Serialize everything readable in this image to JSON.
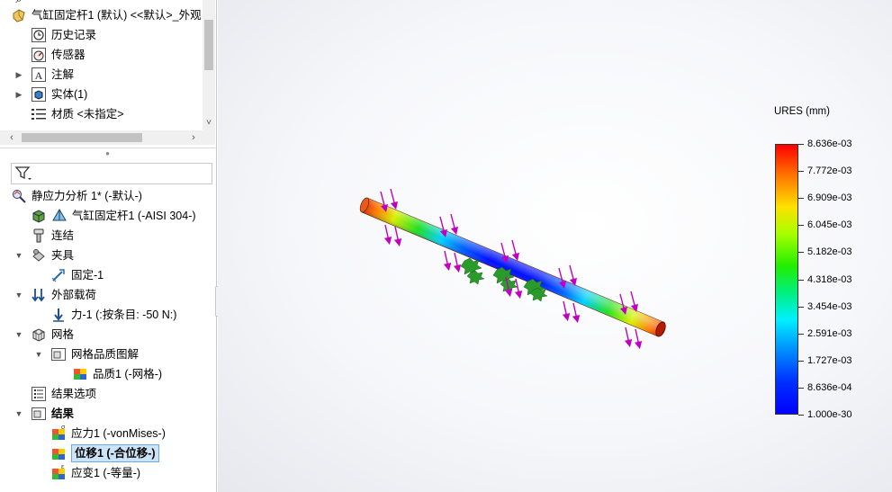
{
  "top_tree": {
    "items": [
      {
        "label": "",
        "icon": "search-icon"
      },
      {
        "label": "气缸固定杆1 (默认) <<默认>_外观",
        "icon": "part-icon"
      },
      {
        "label": "历史记录",
        "icon": "history-icon"
      },
      {
        "label": "传感器",
        "icon": "sensor-icon"
      },
      {
        "label": "注解",
        "icon": "annotation-icon"
      },
      {
        "label": "实体(1)",
        "icon": "solid-body-icon"
      },
      {
        "label": "材质 <未指定>",
        "icon": "material-icon"
      }
    ]
  },
  "filter": {
    "icon": "filter-icon"
  },
  "study_tree": {
    "items": [
      {
        "label": "静应力分析 1* (-默认-)",
        "icon": "static-study-icon"
      },
      {
        "label": "气缸固定杆1 (-AISI 304-)",
        "icon": "solid-part-icon"
      },
      {
        "label": "连结",
        "icon": "connections-icon"
      },
      {
        "label": "夹具",
        "icon": "fixtures-icon"
      },
      {
        "label": "固定-1",
        "icon": "fixed-geometry-icon"
      },
      {
        "label": "外部载荷",
        "icon": "external-loads-icon"
      },
      {
        "label": "力-1 (:按条目: -50 N:)",
        "icon": "force-icon"
      },
      {
        "label": "网格",
        "icon": "mesh-icon"
      },
      {
        "label": "网格品质图解",
        "icon": "mesh-quality-folder-icon"
      },
      {
        "label": "品质1 (-网格-)",
        "icon": "quality-plot-icon"
      },
      {
        "label": "结果选项",
        "icon": "result-options-icon"
      },
      {
        "label": "结果",
        "icon": "results-folder-icon"
      },
      {
        "label": "应力1 (-vonMises-)",
        "icon": "stress-plot-icon"
      },
      {
        "label": "位移1 (-合位移-)",
        "icon": "displacement-plot-icon"
      },
      {
        "label": "应变1 (-等量-)",
        "icon": "strain-plot-icon"
      }
    ]
  },
  "legend": {
    "title": "URES (mm)",
    "labels": [
      "8.636e-03",
      "7.772e-03",
      "6.909e-03",
      "6.045e-03",
      "5.182e-03",
      "4.318e-03",
      "3.454e-03",
      "2.591e-03",
      "1.727e-03",
      "8.636e-04",
      "1.000e-30"
    ],
    "colors": {
      "max": "#ff0000",
      "mid": "#00ff00",
      "min": "#0000ff"
    }
  }
}
